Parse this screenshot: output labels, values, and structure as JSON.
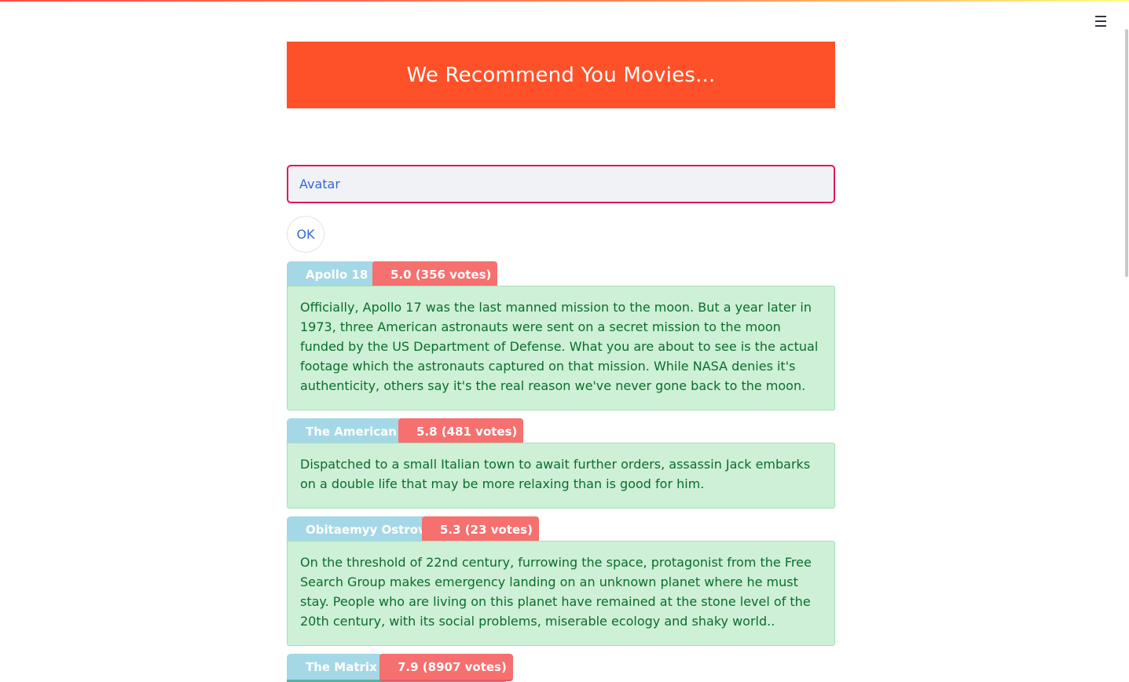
{
  "app": {
    "title": "We Recommend You Movies...",
    "menu_icon": "hamburger-menu-icon"
  },
  "search": {
    "value": "Avatar",
    "button_label": "OK"
  },
  "colors": {
    "banner": "#ff5129",
    "input_border": "#e8145e",
    "title_pill": "#a5d8e6",
    "rating_pill": "#f5706f",
    "overview_bg": "#cdf0d6",
    "overview_text": "#0b6d2c"
  },
  "movies": [
    {
      "title": "Apollo 18 -",
      "rating": "5.0 (356 votes)",
      "overview": "Officially, Apollo 17 was the last manned mission to the moon. But a year later in 1973, three American astronauts were sent on a secret mission to the moon funded by the US Department of Defense. What you are about to see is the actual footage which the astronauts captured on that mission. While NASA denies it's authenticity, others say it's the real reason we've never gone back to the moon."
    },
    {
      "title": "The American -",
      "rating": "5.8 (481 votes)",
      "overview": "Dispatched to a small Italian town to await further orders, assassin Jack embarks on a double life that may be more relaxing than is good for him."
    },
    {
      "title": "Obitaemyy Ostrov -",
      "rating": "5.3 (23 votes)",
      "overview": "On the threshold of 22nd century, furrowing the space, protagonist from the Free Search Group makes emergency landing on an unknown planet where he must stay. People who are living on this planet have remained at the stone level of the 20th century, with its social problems, miserable ecology and shaky world.."
    },
    {
      "title": "The Matrix -",
      "rating": "7.9 (8907 votes)",
      "overview": ""
    }
  ]
}
